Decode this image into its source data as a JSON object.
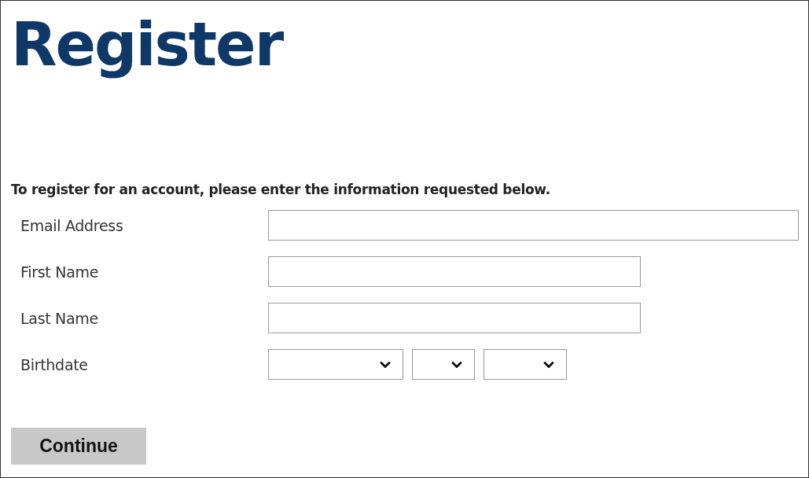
{
  "title": "Register",
  "instructions": "To register for an account, please enter the information requested below.",
  "fields": [
    {
      "label": "Email Address",
      "kind": "email"
    },
    {
      "label": "First Name",
      "kind": "text"
    },
    {
      "label": "Last Name",
      "kind": "text"
    },
    {
      "label": "Birthdate",
      "kind": "date"
    }
  ],
  "button": "Continue"
}
